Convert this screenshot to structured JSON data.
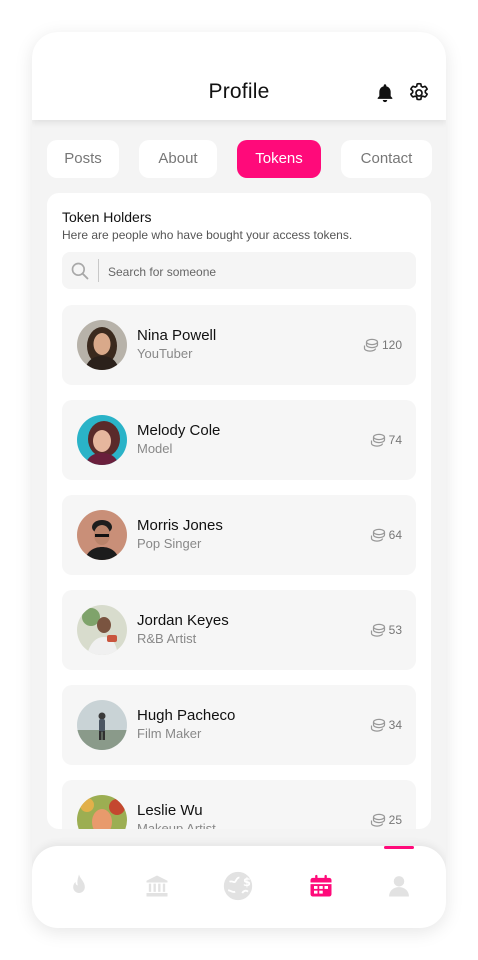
{
  "header": {
    "title": "Profile",
    "bell_icon": "bell-icon",
    "settings_icon": "gear-icon"
  },
  "tabs": [
    {
      "label": "Posts",
      "active": false
    },
    {
      "label": "About",
      "active": false
    },
    {
      "label": "Tokens",
      "active": true
    },
    {
      "label": "Contact",
      "active": false
    }
  ],
  "section": {
    "title": "Token Holders",
    "subtitle": "Here are people who have bought your access tokens."
  },
  "search": {
    "placeholder": "Search for someone",
    "value": ""
  },
  "holders": [
    {
      "name": "Nina Powell",
      "role": "YouTuber",
      "tokens": "120"
    },
    {
      "name": "Melody Cole",
      "role": "Model",
      "tokens": "74"
    },
    {
      "name": "Morris Jones",
      "role": "Pop Singer",
      "tokens": "64"
    },
    {
      "name": "Jordan Keyes",
      "role": "R&B Artist",
      "tokens": "53"
    },
    {
      "name": "Hugh Pacheco",
      "role": "Film Maker",
      "tokens": "34"
    },
    {
      "name": "Leslie Wu",
      "role": "Makeup Artist",
      "tokens": "25"
    }
  ],
  "bottom_nav": [
    {
      "icon": "flame-icon",
      "active": false
    },
    {
      "icon": "bank-icon",
      "active": false
    },
    {
      "icon": "globe-dollar-icon",
      "active": false
    },
    {
      "icon": "calendar-icon",
      "active": true
    },
    {
      "icon": "user-icon",
      "active": false
    }
  ],
  "colors": {
    "accent": "#ff0a7a",
    "inactive_icon": "#e2e2e2",
    "background": "#f4f4f4"
  }
}
